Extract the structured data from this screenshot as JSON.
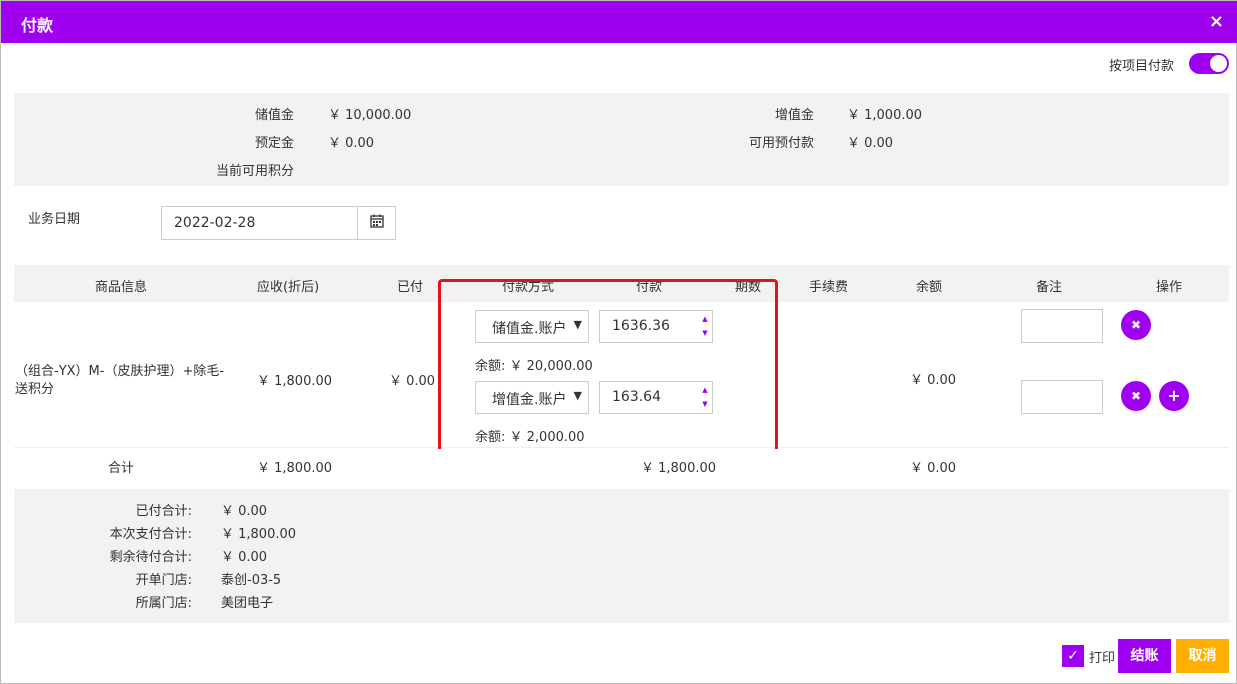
{
  "dialog": {
    "title": "付款",
    "close": "×"
  },
  "toggle": {
    "label": "按项目付款"
  },
  "balances": {
    "stored_label": "储值金",
    "stored_value": "￥ 10,000.00",
    "bonus_label": "增值金",
    "bonus_value": "￥ 1,000.00",
    "deposit_label": "预定金",
    "deposit_value": "￥ 0.00",
    "prepaid_label": "可用预付款",
    "prepaid_value": "￥ 0.00",
    "points_label": "当前可用积分"
  },
  "date": {
    "label": "业务日期",
    "value": "2022-02-28"
  },
  "table": {
    "headers": [
      "商品信息",
      "应收(折后)",
      "已付",
      "付款方式",
      "付款",
      "期数",
      "手续费",
      "余额",
      "备注",
      "操作"
    ],
    "row": {
      "product_line1": "（组合-YX）M-（皮肤护理）+除毛-",
      "product_line2": "送积分",
      "receivable": "￥ 1,800.00",
      "paid": "￥ 0.00",
      "balance": "￥ 0.00",
      "payments": [
        {
          "method": "储值金.账户",
          "amount": "1636.36",
          "remain": "余额: ￥ 20,000.00"
        },
        {
          "method": "增值金.账户",
          "amount": "163.64",
          "remain": "余额: ￥ 2,000.00"
        }
      ]
    },
    "total": {
      "label": "合计",
      "receivable": "￥ 1,800.00",
      "pay": "￥ 1,800.00",
      "balance": "￥ 0.00"
    }
  },
  "summary": [
    {
      "label": "已付合计:",
      "value": "￥ 0.00"
    },
    {
      "label": "本次支付合计:",
      "value": "￥ 1,800.00"
    },
    {
      "label": "剩余待付合计:",
      "value": "￥ 0.00"
    },
    {
      "label": "开单门店:",
      "value": "泰创-03-5"
    },
    {
      "label": "所属门店:",
      "value": "美团电子"
    }
  ],
  "footer": {
    "print_label": "打印",
    "checkout_label": "结账",
    "cancel_label": "取消"
  },
  "colors": {
    "accent": "#a000f0",
    "cancel": "#ffb000",
    "highlight": "#e0141c"
  }
}
